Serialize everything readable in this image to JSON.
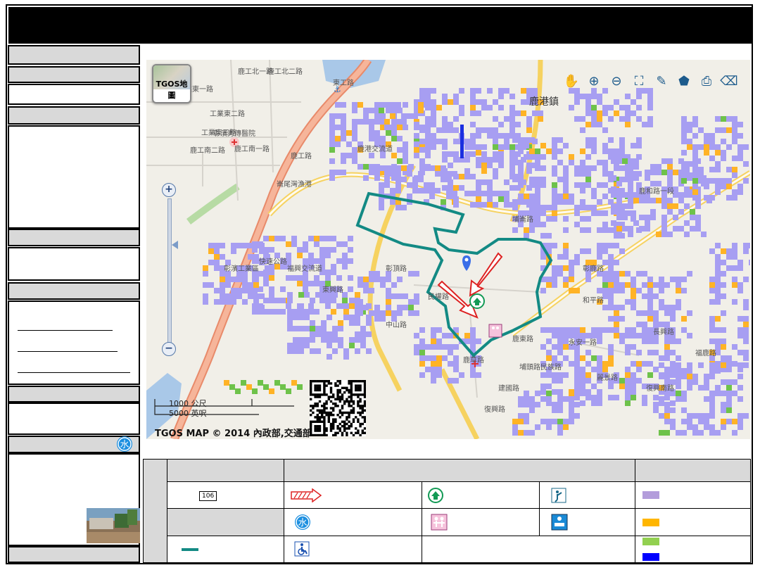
{
  "map": {
    "logo_label": "TGOS地圖",
    "credit": "TGOS MAP © 2014 內政部,交通部",
    "scale_km": "1000 公尺",
    "scale_ft": "5000 英呎",
    "town_label": "鹿港鎮",
    "labels": [
      "鹿工北一路",
      "鹿工北二路",
      "工業東一路",
      "工業東二路",
      "工業東三路",
      "彰濱秀傳醫院",
      "鹿工南一路",
      "鹿工南二路",
      "鹿工路",
      "東工路",
      "崙尾灣漁港",
      "鹿港交流道",
      "彰濱工業區",
      "快速公路",
      "福興交流道",
      "鹿和路一段",
      "中山路",
      "民權路",
      "彰鹿路",
      "鹿東路",
      "建國路",
      "埔頭路",
      "民族路",
      "復興路",
      "永安一路",
      "彰頂路",
      "東興路",
      "麗景路",
      "復興南路",
      "長興路",
      "和平路",
      "鹿草路",
      "埔崙路",
      "福鹿路"
    ],
    "toolbar": [
      "pan-icon",
      "zoom-in-icon",
      "zoom-out-icon",
      "full-extent-icon",
      "draw-icon",
      "draw-shape-icon",
      "print-icon",
      "erase-icon"
    ]
  },
  "legend": {
    "colors": {
      "c1": "#b39ddb",
      "c2": "#ffb600",
      "c3": "#92d050",
      "c4": "#0000ff"
    },
    "route_color": "#138a84",
    "road_shield": "106"
  },
  "colors": {
    "purple": "#a79ef2",
    "orange": "#ffb326",
    "green": "#6ec24a",
    "blue": "#1b2fe0",
    "route": "#138a84",
    "highway": "#f2b8a0",
    "main_road": "#f6d260",
    "water": "#a9c8e8"
  }
}
